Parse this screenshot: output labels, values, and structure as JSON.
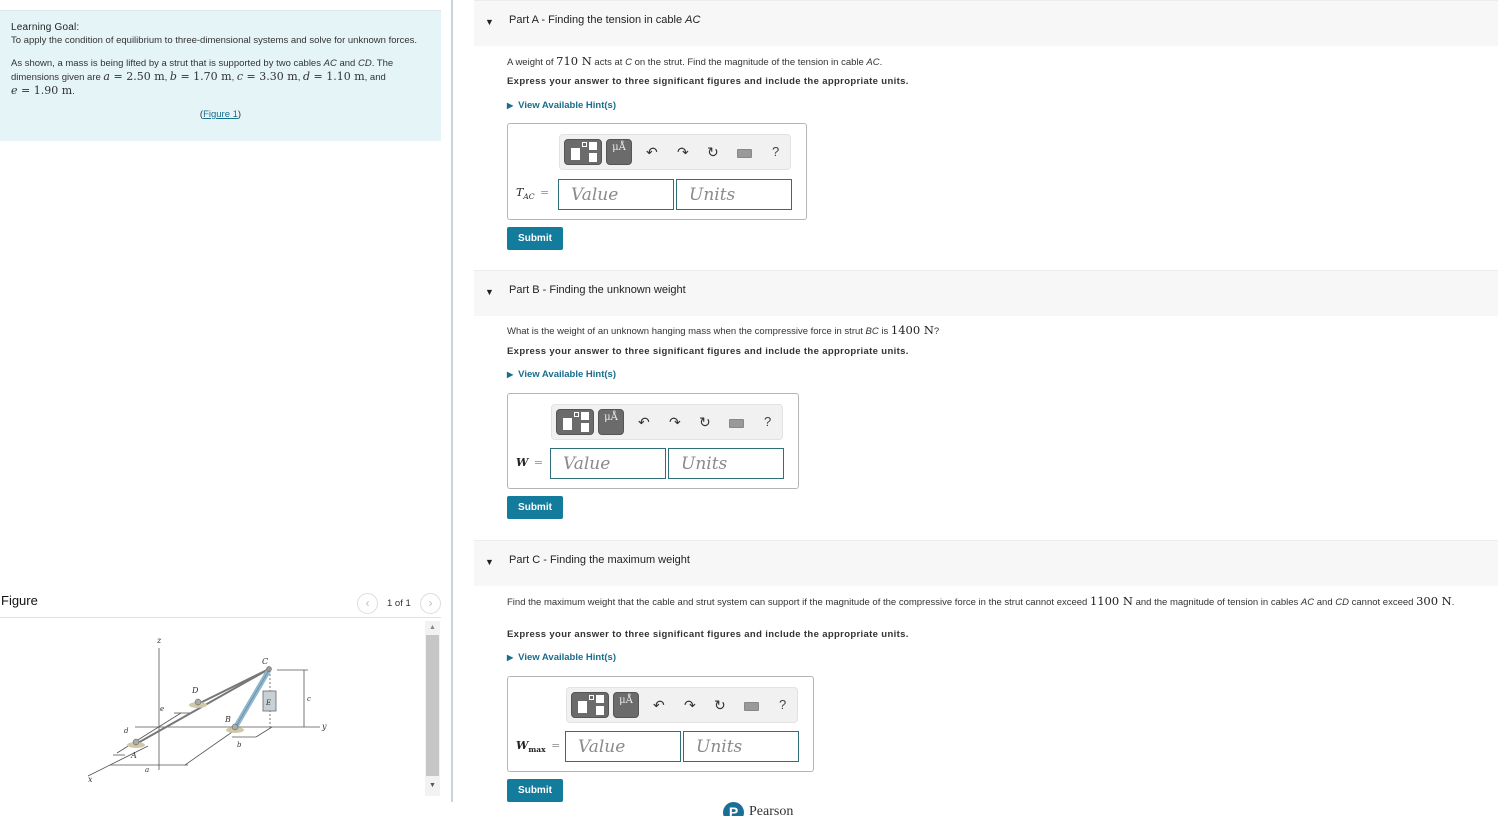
{
  "learning_goal": {
    "heading": "Learning Goal:",
    "objective": "To apply the condition of equilibrium to three-dimensional systems and solve for unknown forces.",
    "intro_prefix": "As shown, a mass is being lifted by a strut that is supported by two cables ",
    "cable1": "AC",
    "and_word": " and ",
    "cable2": "CD",
    "intro_suffix": ". The dimensions given are ",
    "dims": [
      {
        "var": "a",
        "value": "2.50 m"
      },
      {
        "var": "b",
        "value": "1.70 m"
      },
      {
        "var": "c",
        "value": "3.30 m"
      },
      {
        "var": "d",
        "value": "1.10 m"
      },
      {
        "var": "e",
        "value": "1.90 m"
      }
    ],
    "figure_link": "Figure 1"
  },
  "figure": {
    "title": "Figure",
    "page_indicator": "1 of 1",
    "labels": {
      "z": "z",
      "y": "y",
      "x": "x",
      "A": "A",
      "B": "B",
      "C": "C",
      "D": "D",
      "E": "E",
      "a": "a",
      "b": "b",
      "c": "c",
      "d": "d",
      "e": "e"
    }
  },
  "parts": [
    {
      "caret": "▼",
      "title_prefix": "Part A",
      "title_text": " - Finding the tension in cable ",
      "title_italic": "AC",
      "question": {
        "t1": "A weight of ",
        "v1": "710 N",
        "t2": " acts at ",
        "i1": "C",
        "t3": " on the strut. Find the magnitude of the tension in cable ",
        "i2": "AC",
        "t4": "."
      },
      "instruction": "Express your answer to three significant figures and include the appropriate units.",
      "hint": "View Available Hint(s)",
      "answer_label": "T",
      "answer_sub": "AC",
      "value_placeholder": "Value",
      "units_placeholder": "Units",
      "submit": "Submit"
    },
    {
      "caret": "▼",
      "title_prefix": "Part B",
      "title_text": " - Finding the unknown weight",
      "title_italic": "",
      "question": {
        "t1": "What is the weight of an unknown hanging mass when the compressive force in strut ",
        "i1": "BC",
        "t2": " is ",
        "v1": "1400 N",
        "t3": "?"
      },
      "instruction": "Express your answer to three significant figures and include the appropriate units.",
      "hint": "View Available Hint(s)",
      "answer_label": "W",
      "answer_sub": "",
      "value_placeholder": "Value",
      "units_placeholder": "Units",
      "submit": "Submit"
    },
    {
      "caret": "▼",
      "title_prefix": "Part C",
      "title_text": " - Finding the maximum weight",
      "title_italic": "",
      "question": {
        "t1": "Find the maximum weight that the cable and strut system can support if the magnitude of the compressive force in the strut cannot exceed ",
        "v1": "1100 N",
        "t2": " and the magnitude of tension in cables ",
        "i1": "AC",
        "t3": " and ",
        "i2": "CD",
        "t4": " cannot exceed ",
        "v2": "300 N",
        "t5": "."
      },
      "instruction": "Express your answer to three significant figures and include the appropriate units.",
      "hint": "View Available Hint(s)",
      "answer_label": "W",
      "answer_sub": "max",
      "value_placeholder": "Value",
      "units_placeholder": "Units",
      "submit": "Submit"
    }
  ],
  "toolbar": {
    "templates_icon": "templates-icon",
    "units_label": "μÅ",
    "undo": "↶",
    "redo": "↷",
    "reset": "↻",
    "keyboard_icon": "keyboard-icon",
    "help": "?"
  },
  "footer": {
    "logo_letter": "P",
    "brand": "Pearson"
  }
}
